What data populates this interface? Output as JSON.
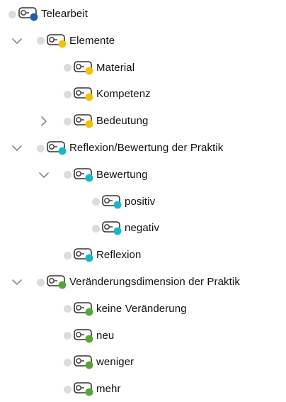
{
  "colors": {
    "blue": "#1f5aa8",
    "yellow": "#f2c200",
    "cyan": "#16b7c9",
    "green": "#56a637",
    "dot_gray": "#dcdcdc",
    "chevron_gray": "#8a8a8a"
  },
  "tree": [
    {
      "label": "Telearbeit",
      "level": 0,
      "color": "blue",
      "chevron": "none"
    },
    {
      "label": "Elemente",
      "level": 1,
      "color": "yellow",
      "chevron": "down"
    },
    {
      "label": "Material",
      "level": 2,
      "color": "yellow",
      "chevron": "none"
    },
    {
      "label": "Kompetenz",
      "level": 2,
      "color": "yellow",
      "chevron": "none"
    },
    {
      "label": "Bedeutung",
      "level": 2,
      "color": "yellow",
      "chevron": "right"
    },
    {
      "label": "Reflexion/Bewertung der Praktik",
      "level": 1,
      "color": "cyan",
      "chevron": "down"
    },
    {
      "label": "Bewertung",
      "level": 2,
      "color": "cyan",
      "chevron": "down"
    },
    {
      "label": "positiv",
      "level": 3,
      "color": "cyan",
      "chevron": "none"
    },
    {
      "label": "negativ",
      "level": 3,
      "color": "cyan",
      "chevron": "none"
    },
    {
      "label": "Reflexion",
      "level": 2,
      "color": "cyan",
      "chevron": "none"
    },
    {
      "label": "Veränderungsdimension der Praktik",
      "level": 1,
      "color": "green",
      "chevron": "down"
    },
    {
      "label": "keine Veränderung",
      "level": 2,
      "color": "green",
      "chevron": "none"
    },
    {
      "label": "neu",
      "level": 2,
      "color": "green",
      "chevron": "none"
    },
    {
      "label": "weniger",
      "level": 2,
      "color": "green",
      "chevron": "none"
    },
    {
      "label": "mehr",
      "level": 2,
      "color": "green",
      "chevron": "none"
    }
  ]
}
